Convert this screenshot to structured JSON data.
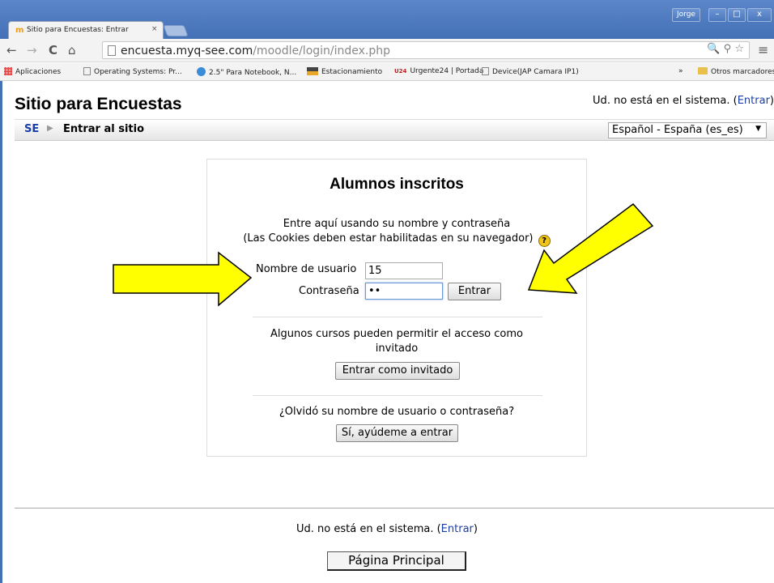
{
  "browser": {
    "user_label": "Jorge",
    "window_controls": [
      "–",
      "□",
      "x"
    ],
    "tab": {
      "favicon": "m",
      "title": "Sitio para Encuestas: Entrar",
      "close": "×"
    },
    "nav": {
      "back": "←",
      "forward": "→",
      "reload": "C",
      "home": "⌂"
    },
    "url": {
      "host": "encuesta.myq-see.com",
      "path": "/moodle/login/index.php"
    },
    "url_icons": "🔍 ⚲ ☆",
    "menu": "≡",
    "bookmarks": [
      {
        "label": "Aplicaciones"
      },
      {
        "label": "Operating Systems: Pr..."
      },
      {
        "label": "2.5\" Para Notebook, N..."
      },
      {
        "label": "Estacionamiento"
      },
      {
        "label": "Urgente24 | Portada",
        "prefix": "U24"
      },
      {
        "label": "Device(JAP Camara IP1)"
      }
    ],
    "bookmarks_more": "»",
    "other_bookmarks": "Otros marcadores"
  },
  "page": {
    "site_title": "Sitio para Encuestas",
    "login_info_prefix": "Ud. no está en el sistema. (",
    "login_info_link": "Entrar",
    "login_info_suffix": ")",
    "breadcrumb": {
      "home": "SE",
      "separator": "▶",
      "current": "Entrar al sitio"
    },
    "language": {
      "selected": "Español - España (es_es)",
      "arrow": "▼"
    }
  },
  "login": {
    "heading": "Alumnos inscritos",
    "instructions_1": "Entre aquí usando su nombre y contraseña",
    "instructions_2": "(Las Cookies deben estar habilitadas en su navegador)",
    "help": "?",
    "username_label": "Nombre de usuario",
    "username_value": "15",
    "password_label": "Contraseña",
    "password_value": "••",
    "submit": "Entrar",
    "guest_text": "Algunos cursos pueden permitir el acceso como invitado",
    "guest_button": "Entrar como invitado",
    "forgot_text": "¿Olvidó su nombre de usuario o contraseña?",
    "forgot_button": "Sí, ayúdeme a entrar"
  },
  "footer": {
    "info_prefix": "Ud. no está en el sistema. (",
    "info_link": "Entrar",
    "info_suffix": ")",
    "home_button": "Página Principal"
  },
  "colors": {
    "accent": "#1a3ea8",
    "arrow_fill": "#ffff00",
    "chrome": "#4470b6"
  }
}
